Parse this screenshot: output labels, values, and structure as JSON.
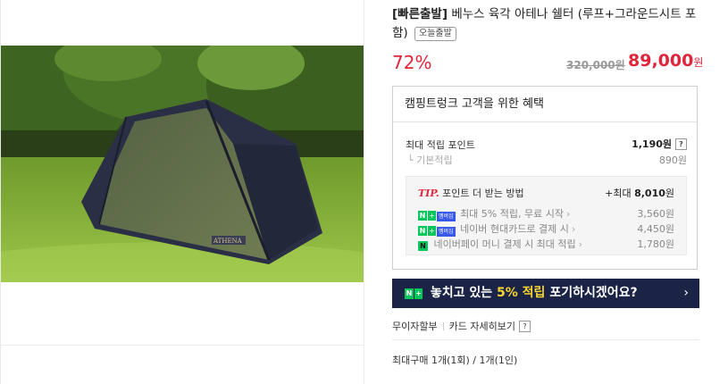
{
  "product": {
    "title_bracket": "[빠른출발]",
    "title_rest": "베누스 육각 아테나 쉘터 (루프+그라운드시트 포함)",
    "badge": "오늘출발",
    "discount": "72%",
    "original_price": "320,000원",
    "price_value": "89,000",
    "price_unit": "원"
  },
  "benefit": {
    "heading": "캠핑트렁크 고객을 위한 혜택",
    "max_points_label": "최대 적립 포인트",
    "max_points_value": "1,190원",
    "help_mark": "?",
    "base_label": "기본적립",
    "base_value": "890원",
    "tip": {
      "tip_label": "TIP.",
      "tip_text": "포인트 더 받는 방법",
      "tip_total_prefix": "+최대",
      "tip_total_value": "8,010",
      "tip_total_unit": "원",
      "items": [
        {
          "text": "최대 5% 적립, 무료 시작",
          "value": "3,560원",
          "logo": "naver-plus-membership"
        },
        {
          "text": "네이버 현대카드로 결제 시",
          "value": "4,450원",
          "logo": "naver-plus-membership"
        },
        {
          "text": "네이버페이 머니 결제 시 최대 적립",
          "value": "1,780원",
          "logo": "naver-pay"
        }
      ],
      "membership_badge": "멤버십"
    }
  },
  "banner": {
    "text_pre": "놓치고 있는",
    "text_highlight": "5% 적립",
    "text_post": "포기하시겠어요?",
    "arrow": "›"
  },
  "links": {
    "installment": "무이자할부",
    "card_benefits": "카드 자세히보기",
    "help_mark": "?"
  },
  "max_purchase": "최대구매 1개(1회) / 1개(1인)",
  "colors": {
    "accent_red": "#e0253b",
    "banner_navy": "#1b2446",
    "naver_green": "#03c75a",
    "highlight_yellow": "#f7d531"
  }
}
